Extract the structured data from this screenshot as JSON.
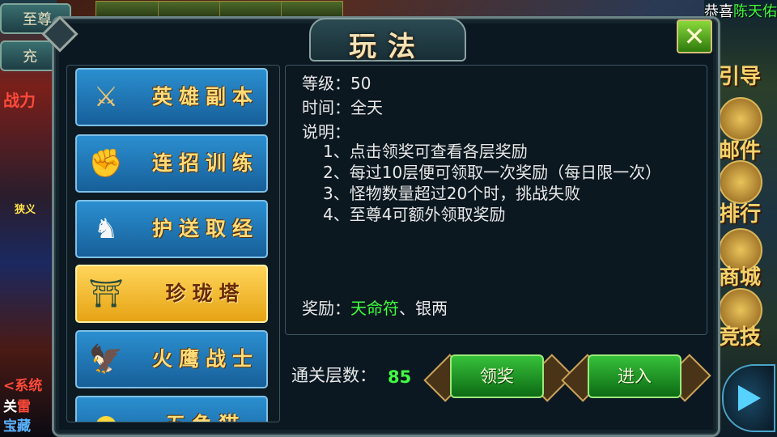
{
  "hud": {
    "btn_top": "至尊",
    "btn_second": "充",
    "congrats_prefix": "恭喜",
    "congrats_name": "陈天佑",
    "left_combat": "战力",
    "left_faction": "狭义",
    "left_fragments": [
      "<系统",
      "关",
      "雷",
      "宝藏"
    ],
    "right_labels": [
      "引导",
      "邮件",
      "排行",
      "商城",
      "竞技"
    ]
  },
  "dialog": {
    "title": "玩法",
    "close_icon": "close-x-icon",
    "menu": [
      {
        "label": "英雄副本",
        "icon": "crossed-swords-icon",
        "selected": false
      },
      {
        "label": "连招训练",
        "icon": "fist-flame-icon",
        "selected": false
      },
      {
        "label": "护送取经",
        "icon": "white-horse-icon",
        "selected": false
      },
      {
        "label": "珍珑塔",
        "icon": "pagoda-icon",
        "selected": true
      },
      {
        "label": "火鹰战士",
        "icon": "fire-hawk-icon",
        "selected": false
      },
      {
        "label": "五色猫",
        "icon": "gold-orb-icon",
        "selected": false
      }
    ],
    "info": {
      "level_label": "等级：",
      "level_value": "50",
      "time_label": "时间：",
      "time_value": "全天",
      "desc_label": "说明：",
      "desc_lines": [
        "1、点击领奖可查看各层奖励",
        "2、每过10层便可领取一次奖励（每日限一次）",
        "3、怪物数量超过20个时，挑战失败",
        "4、至尊4可额外领取奖励"
      ],
      "reward_label": "奖励：",
      "reward_highlight": "天命符",
      "reward_rest": "、银两"
    },
    "progress_label": "通关层数：",
    "progress_value": "85",
    "claim_button": "领奖",
    "enter_button": "进入"
  },
  "colors": {
    "highlight_green": "#3dff3d",
    "menu_blue": "#2b8fd0",
    "menu_selected_gold": "#ffd55a",
    "action_green": "#36c13a"
  }
}
